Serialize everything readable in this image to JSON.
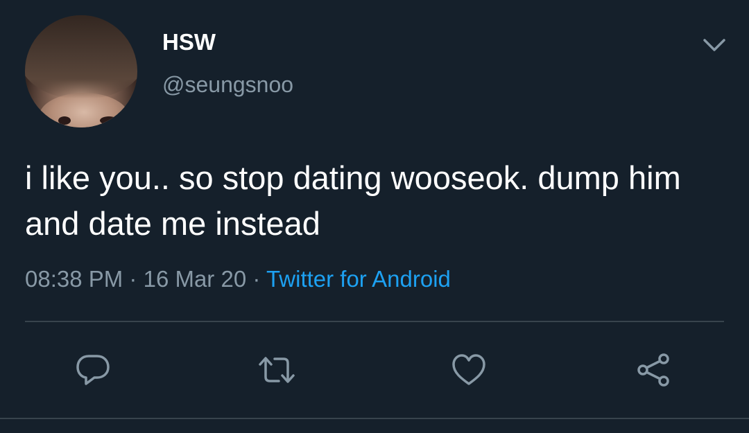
{
  "tweet": {
    "display_name": "HSW",
    "handle": "@seungsnoo",
    "text": "i like you.. so stop dating wooseok. dump him and date me instead",
    "time": "08:38 PM",
    "date": "16 Mar 20",
    "separator": "·",
    "source": "Twitter for Android"
  },
  "icons": {
    "more": "chevron-down-icon",
    "reply": "reply-icon",
    "retweet": "retweet-icon",
    "like": "heart-icon",
    "share": "share-icon"
  },
  "colors": {
    "background": "#15202b",
    "text": "#ffffff",
    "secondary": "#8899a6",
    "accent": "#1da1f2",
    "divider": "#38444d"
  }
}
